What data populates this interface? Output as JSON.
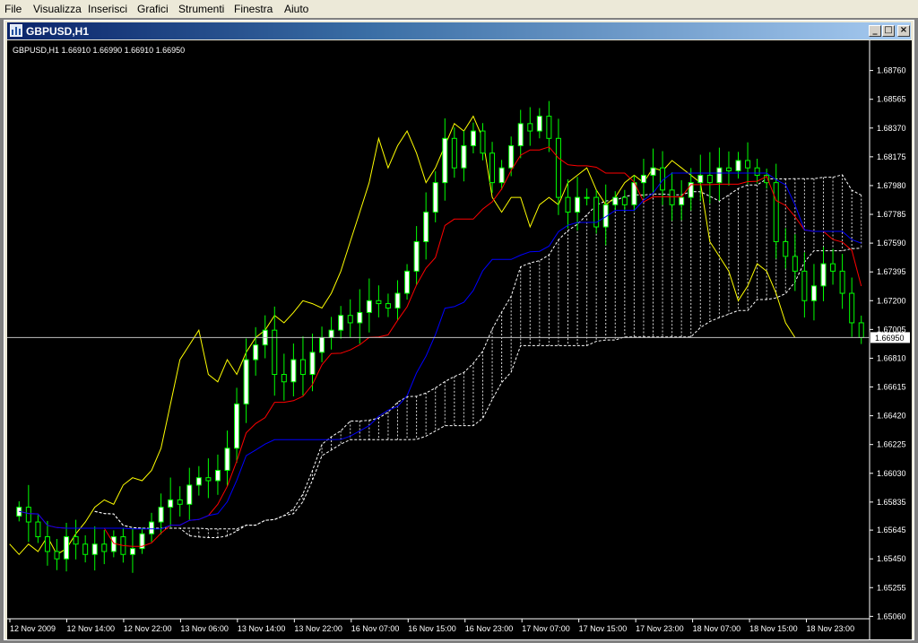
{
  "menu": {
    "items": [
      {
        "label": "File"
      },
      {
        "label": "Visualizza"
      },
      {
        "label": "Inserisci"
      },
      {
        "label": "Grafici"
      },
      {
        "label": "Strumenti"
      },
      {
        "label": "Finestra"
      },
      {
        "label": "Aiuto"
      }
    ]
  },
  "window": {
    "title": "GBPUSD,H1",
    "minimize_label": "_",
    "restore_label": "□",
    "close_label": "×"
  },
  "info_line": "GBPUSD,H1  1.66910 1.66990 1.66910 1.66950",
  "colors": {
    "background": "#000000",
    "bull_candle": "#ffffff",
    "bear_candle": "#000000",
    "wick": "#00ff00",
    "tenkan": "#ff0000",
    "kijun": "#0000ff",
    "chikou": "#ffff00",
    "kumo": "#ffffff",
    "axis_text": "#ffffff",
    "price_line": "#c0c0c0"
  },
  "chart_data": {
    "type": "candlestick",
    "symbol": "GBPUSD",
    "timeframe": "H1",
    "ylim": [
      1.6505,
      1.6894
    ],
    "y_ticks": [
      "1.68760",
      "1.68565",
      "1.68370",
      "1.68175",
      "1.67980",
      "1.67785",
      "1.67590",
      "1.67395",
      "1.67200",
      "1.67005",
      "1.66810",
      "1.66615",
      "1.66420",
      "1.66225",
      "1.66030",
      "1.65835",
      "1.65645",
      "1.65450",
      "1.65255",
      "1.65060"
    ],
    "x_ticks": [
      "12 Nov 2009",
      "12 Nov 14:00",
      "12 Nov 22:00",
      "13 Nov 06:00",
      "13 Nov 14:00",
      "13 Nov 22:00",
      "16 Nov 07:00",
      "16 Nov 15:00",
      "16 Nov 23:00",
      "17 Nov 07:00",
      "17 Nov 15:00",
      "17 Nov 23:00",
      "18 Nov 07:00",
      "18 Nov 15:00",
      "18 Nov 23:00"
    ],
    "current_price": "1.66950",
    "closes": [
      1.658,
      1.657,
      1.656,
      1.655,
      1.6545,
      1.656,
      1.6555,
      1.6548,
      1.6555,
      1.655,
      1.656,
      1.6548,
      1.6552,
      1.6562,
      1.657,
      1.658,
      1.6585,
      1.6582,
      1.6595,
      1.66,
      1.6598,
      1.6605,
      1.662,
      1.665,
      1.668,
      1.669,
      1.67,
      1.667,
      1.6665,
      1.668,
      1.667,
      1.6685,
      1.6695,
      1.67,
      1.671,
      1.6705,
      1.6712,
      1.672,
      1.6718,
      1.6715,
      1.6725,
      1.674,
      1.676,
      1.678,
      1.68,
      1.683,
      1.681,
      1.6825,
      1.6835,
      1.682,
      1.68,
      1.681,
      1.6825,
      1.684,
      1.6835,
      1.6845,
      1.683,
      1.679,
      1.678,
      1.679,
      1.679,
      1.677,
      1.6785,
      1.679,
      1.6785,
      1.68,
      1.6805,
      1.681,
      1.6795,
      1.6785,
      1.679,
      1.68,
      1.6805,
      1.68,
      1.681,
      1.6808,
      1.6815,
      1.681,
      1.6805,
      1.68,
      1.676,
      1.675,
      1.674,
      1.672,
      1.673,
      1.6745,
      1.674,
      1.6725,
      1.6705,
      1.6695
    ]
  }
}
